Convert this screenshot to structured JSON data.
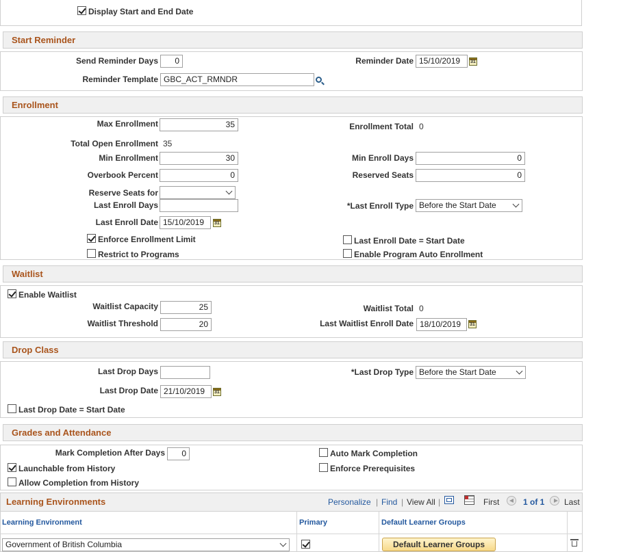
{
  "top": {
    "display_dates_label": "Display Start and End Date",
    "display_dates_checked": true
  },
  "start_reminder": {
    "title": "Start Reminder",
    "send_days_label": "Send Reminder Days",
    "send_days_value": "0",
    "date_label": "Reminder Date",
    "date_value": "15/10/2019",
    "template_label": "Reminder Template",
    "template_value": "GBC_ACT_RMNDR"
  },
  "enrollment": {
    "title": "Enrollment",
    "max_label": "Max Enrollment",
    "max_value": "35",
    "total_label": "Enrollment Total",
    "total_value": "0",
    "open_label": "Total Open Enrollment",
    "open_value": "35",
    "min_label": "Min Enrollment",
    "min_value": "30",
    "min_days_label": "Min Enroll Days",
    "min_days_value": "0",
    "overbook_label": "Overbook Percent",
    "overbook_value": "0",
    "reserved_label": "Reserved Seats",
    "reserved_value": "0",
    "reserve_for_label": "Reserve Seats for",
    "reserve_for_value": "",
    "last_days_label": "Last Enroll Days",
    "last_days_value": "",
    "last_type_label": "*Last Enroll Type",
    "last_type_value": "Before the Start Date",
    "last_date_label": "Last Enroll Date",
    "last_date_value": "15/10/2019",
    "enforce_label": "Enforce Enrollment Limit",
    "enforce_checked": true,
    "last_eq_start_label": "Last Enroll Date = Start Date",
    "last_eq_start_checked": false,
    "restrict_label": "Restrict to Programs",
    "restrict_checked": false,
    "auto_enroll_label": "Enable Program Auto Enrollment",
    "auto_enroll_checked": false
  },
  "waitlist": {
    "title": "Waitlist",
    "enable_label": "Enable Waitlist",
    "enable_checked": true,
    "capacity_label": "Waitlist Capacity",
    "capacity_value": "25",
    "total_label": "Waitlist Total",
    "total_value": "0",
    "threshold_label": "Waitlist Threshold",
    "threshold_value": "20",
    "last_date_label": "Last Waitlist Enroll Date",
    "last_date_value": "18/10/2019"
  },
  "drop_class": {
    "title": "Drop Class",
    "days_label": "Last Drop Days",
    "days_value": "",
    "type_label": "*Last Drop Type",
    "type_value": "Before the Start Date",
    "date_label": "Last Drop Date",
    "date_value": "21/10/2019",
    "eq_start_label": "Last Drop Date = Start Date",
    "eq_start_checked": false
  },
  "grades": {
    "title": "Grades and Attendance",
    "mark_after_label": "Mark Completion After Days",
    "mark_after_value": "0",
    "auto_mark_label": "Auto Mark Completion",
    "auto_mark_checked": false,
    "launchable_label": "Launchable from History",
    "launchable_checked": true,
    "enforce_prereq_label": "Enforce Prerequisites",
    "enforce_prereq_checked": false,
    "allow_label": "Allow Completion from History",
    "allow_checked": false
  },
  "learning_env": {
    "title": "Learning Environments",
    "personalize": "Personalize",
    "find": "Find",
    "view_all": "View All",
    "first": "First",
    "pager": "1 of 1",
    "last": "Last",
    "col_env": "Learning Environment",
    "col_primary": "Primary",
    "col_groups": "Default Learner Groups",
    "row_env": "Government of British Columbia",
    "row_primary_checked": true,
    "row_groups_button": "Default Learner Groups"
  }
}
